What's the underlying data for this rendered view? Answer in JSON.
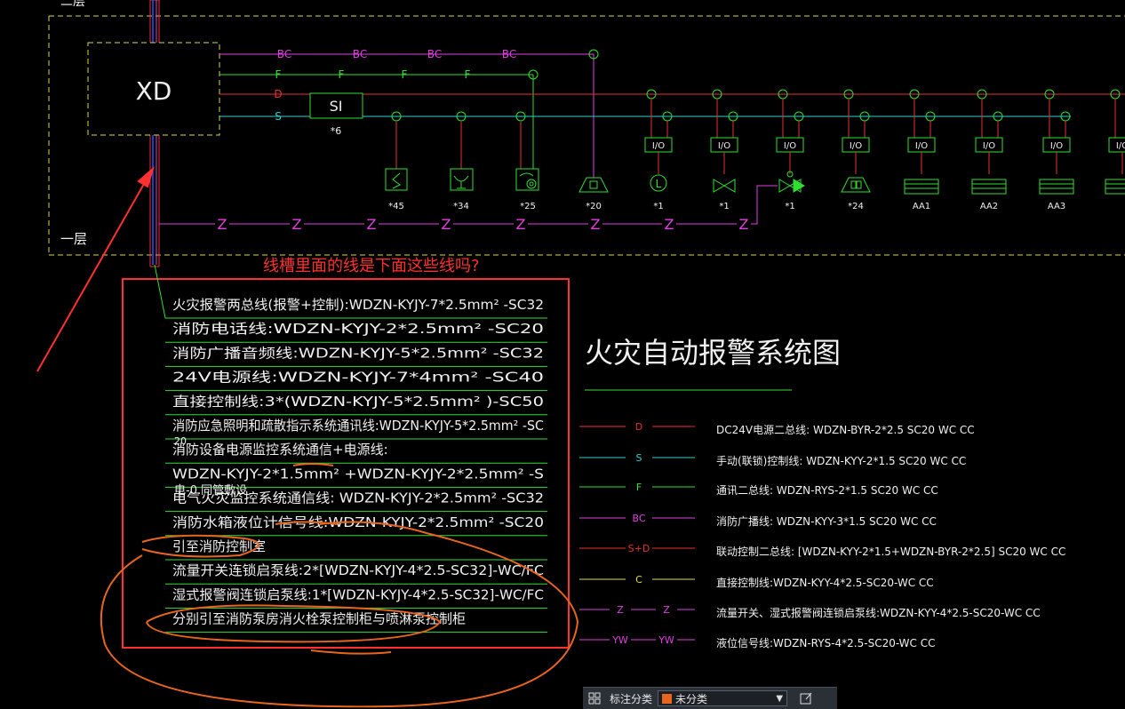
{
  "layout": {
    "floor_label": "一层",
    "floor_label_top": "二层",
    "xd_label": "XD",
    "si_label": "SI",
    "si_count": "*6",
    "line_labels": {
      "bc": "BC",
      "f": "F",
      "d": "D",
      "s": "S",
      "z": "Z"
    }
  },
  "devices": [
    {
      "name": "smoke-detector",
      "count": "*45"
    },
    {
      "name": "heat-detector",
      "count": "*34"
    },
    {
      "name": "manual-alarm-button",
      "count": "*25"
    },
    {
      "name": "speaker",
      "count": "*20"
    },
    {
      "name": "flow-switch",
      "count": "*1"
    },
    {
      "name": "valve",
      "count": "*1"
    },
    {
      "name": "signal-valve",
      "count": "*1"
    },
    {
      "name": "alarm-bell",
      "count": "*24"
    },
    {
      "name": "panel-aa1",
      "count": "AA1"
    },
    {
      "name": "panel-aa2",
      "count": "AA2"
    },
    {
      "name": "panel-aa3",
      "count": "AA3"
    }
  ],
  "module_label": "I/O",
  "question": "线槽里面的线是下面这些线吗?",
  "cable_list": [
    "火灾报警两总线(报警+控制):WDZN-KYJY-7*2.5mm²   -SC32",
    "消防电话线:WDZN-KYJY-2*2.5mm²   -SC20",
    "消防广播音频线:WDZN-KYJY-5*2.5mm²   -SC32",
    "24V电源线:WDZN-KYJY-7*4mm²   -SC40",
    "直接控制线:3*(WDZN-KYJY-5*2.5mm²   )-SC50",
    "消防应急照明和疏散指示系统通讯线:WDZN-KYJY-5*2.5mm²   -SC",
    "消防设备电源监控系统通信+电源线:",
    "WDZN-KYJY-2*1.5mm²   +WDZN-KYJY-2*2.5mm²   -S",
    "电气火灾监控系统通信线: WDZN-KYJY-2*2.5mm²   -SC32",
    "消防水箱液位计信号线:WDZN-KYJY-2*2.5mm²   -SC20",
    "引至消防控制室",
    "流量开关连锁启泵线:2*[WDZN-KYJY-4*2.5-SC32]-WC/FC",
    "湿式报警阀连锁启泵线:1*[WDZN-KYJY-4*2.5-SC32]-WC/FC",
    "分别引至消防泵房消火栓泵控制柜与喷淋泵控制柜"
  ],
  "overlap_fragments": {
    "a": "20",
    "b": "电-0.同管敷设"
  },
  "system_title": "火灾自动报警系统图",
  "legend": [
    {
      "tag": "D",
      "text": "DC24V电源二总线: WDZN-BYR-2*2.5  SC20  WC  CC",
      "color": "#e83030"
    },
    {
      "tag": "S",
      "text": "手动(联锁)控制线: WDZN-KYY-2*1.5    SC20  WC  CC",
      "color": "#30d0d0"
    },
    {
      "tag": "F",
      "text": "通讯二总线: WDZN-RYS-2*1.5    SC20  WC  CC",
      "color": "#30e030"
    },
    {
      "tag": "BC",
      "text": "消防广播线: WDZN-KYY-3*1.5    SC20  WC  CC",
      "color": "#e040e0"
    },
    {
      "tag": "S+D",
      "text": "联动控制二总线: [WDZN-KYY-2*1.5+WDZN-BYR-2*2.5]  SC20  WC  CC",
      "color": "#e83030"
    },
    {
      "tag": "C",
      "text": "直接控制线:WDZN-KYY-4*2.5-SC20-WC  CC",
      "color": "#e0e040"
    },
    {
      "tag": "Z",
      "tag2": "Z",
      "text": "流量开关、湿式报警阀连锁启泵线:WDZN-KYY-4*2.5-SC20-WC  CC",
      "color": "#e040e0"
    },
    {
      "tag": "YW",
      "tag2": "YW",
      "text": "液位信号线:WDZN-RYS-4*2.5-SC20-WC  CC",
      "color": "#e040e0"
    }
  ],
  "toolbar": {
    "label": "标注分类",
    "selected": "未分类",
    "swatch_color": "#e8651d"
  },
  "colors": {
    "bg": "#000000",
    "green": "#30e030",
    "red": "#e83030",
    "cyan": "#30d0d0",
    "magenta": "#e040e0",
    "yellow_dash": "#d8d850",
    "white": "#f0f0f0",
    "annotation_red": "#ff3030",
    "annotation_orange": "#e8651d"
  }
}
